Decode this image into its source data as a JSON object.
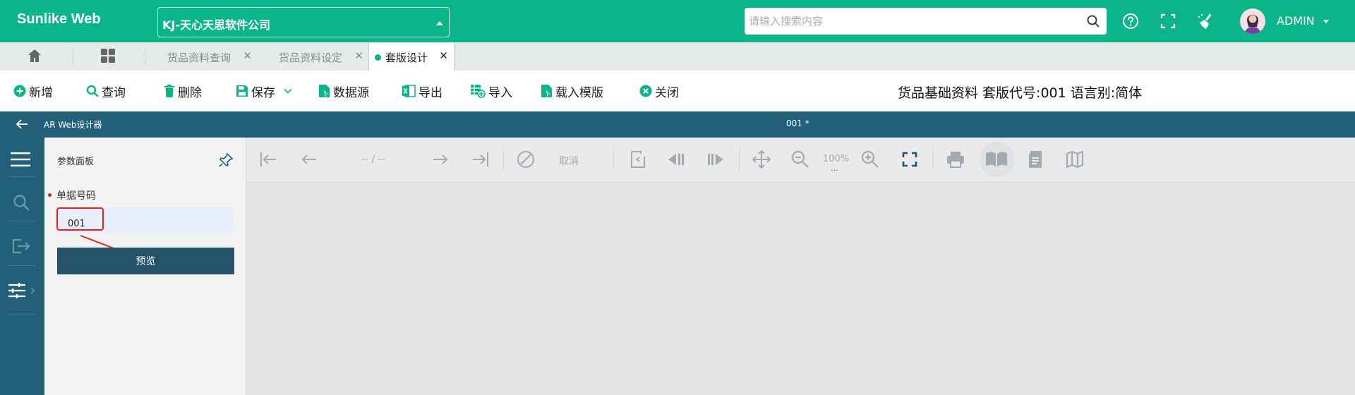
{
  "header": {
    "brand": "Sunlike Web",
    "company": "KJ-天心天思软件公司",
    "search_placeholder": "请输入搜索内容",
    "user": "ADMIN"
  },
  "tabs": [
    {
      "label": "货品资料查询",
      "active": false
    },
    {
      "label": "货品资料设定",
      "active": false
    },
    {
      "label": "套版设计",
      "active": true
    }
  ],
  "toolbar": {
    "new": "新增",
    "query": "查询",
    "delete": "删除",
    "save": "保存",
    "datasource": "数据源",
    "export": "导出",
    "import": "导入",
    "load_template": "载入模版",
    "close": "关闭",
    "doc_title": "货品基础资料 套版代号:001 语言别:简体"
  },
  "designer": {
    "title": "AR Web设计器",
    "doc": "001 *"
  },
  "param_panel": {
    "title": "参数面板",
    "field_label": "单据号码",
    "field_value": "001",
    "preview_button": "预览"
  },
  "viewer_toolbar": {
    "page_info": "-- / --",
    "cancel": "取消",
    "zoom": "100%",
    "zoom_more": "..."
  },
  "colors": {
    "primary": "#0bb58a",
    "designer_bar": "#22607a",
    "preview_button": "#24536a",
    "annotation": "#e3231e"
  }
}
